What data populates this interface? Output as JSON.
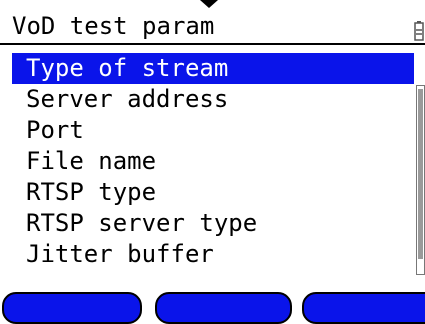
{
  "header": {
    "title": "VoD test param",
    "battery_icon": "battery-icon"
  },
  "menu": {
    "selected_index": 0,
    "items": [
      {
        "label": "Type of stream"
      },
      {
        "label": "Server address"
      },
      {
        "label": "Port"
      },
      {
        "label": "File name"
      },
      {
        "label": "RTSP type"
      },
      {
        "label": "RTSP server type"
      },
      {
        "label": "Jitter buffer"
      }
    ]
  },
  "softkeys": [
    {
      "label": ""
    },
    {
      "label": ""
    },
    {
      "label": ""
    }
  ],
  "colors": {
    "accent": "#0a14ea",
    "text": "#000000",
    "background": "#ffffff"
  }
}
